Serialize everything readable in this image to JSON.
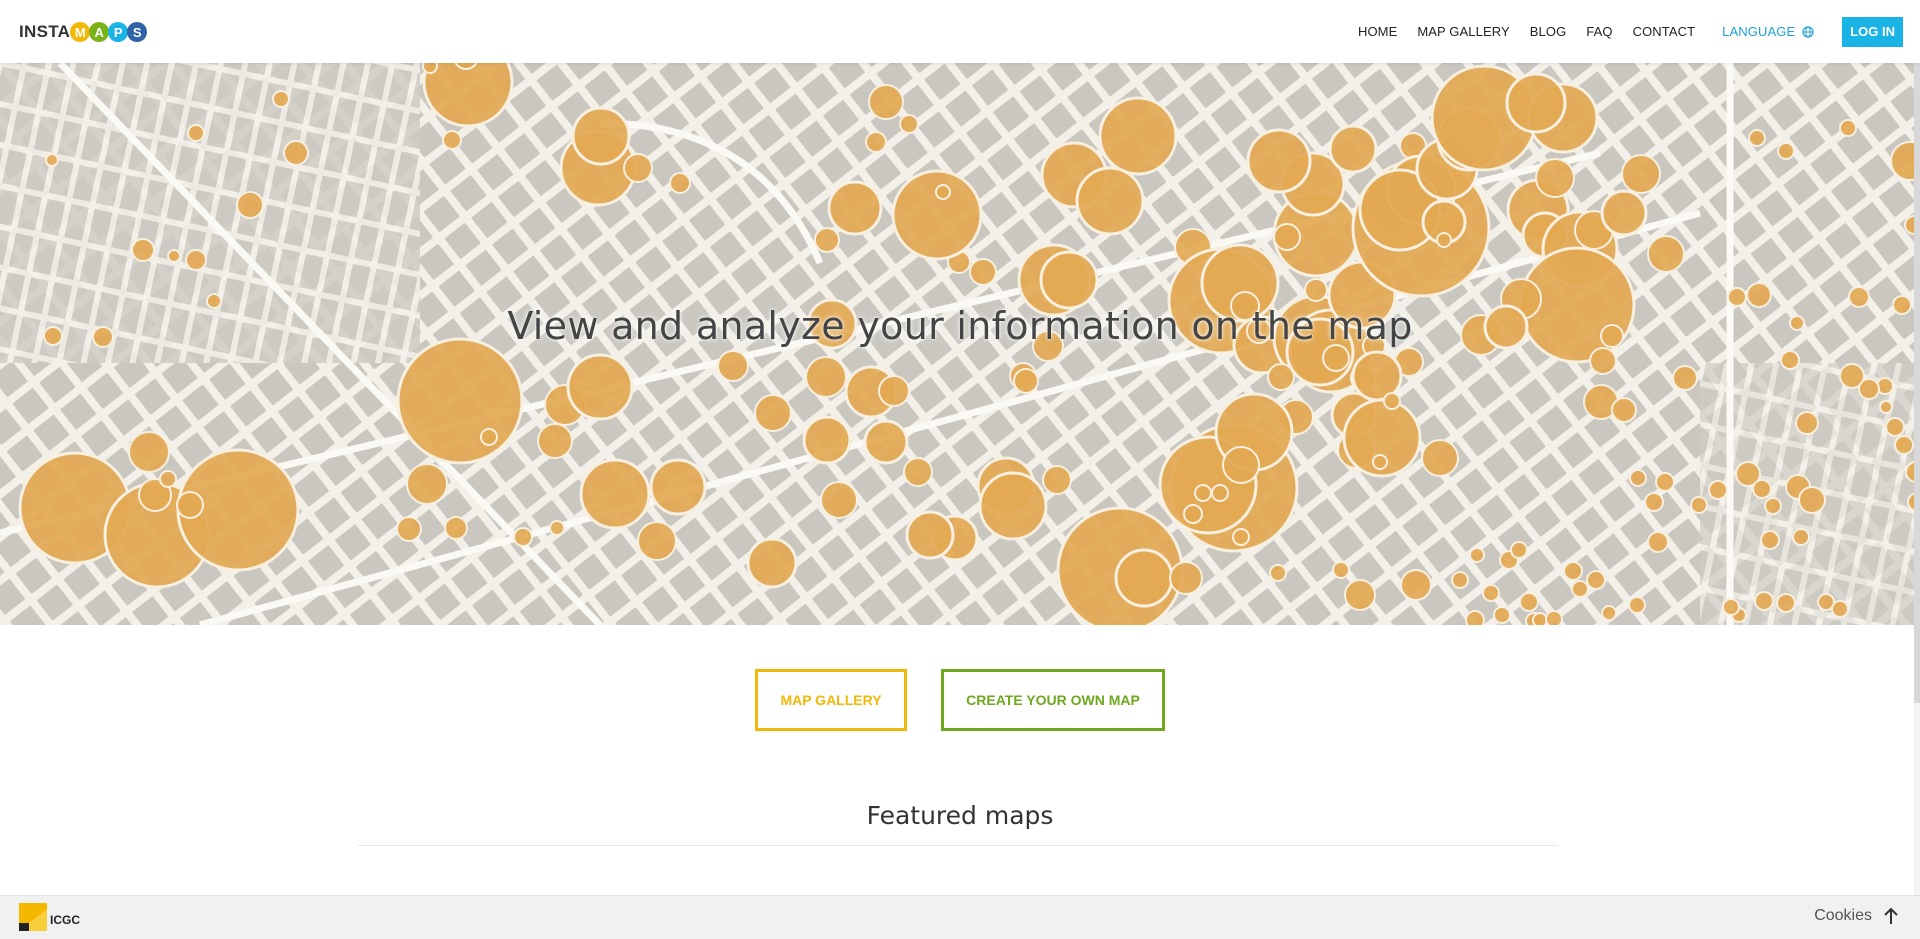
{
  "header": {
    "logo_text": "INSTA",
    "logo_badges": [
      {
        "letter": "M",
        "color": "#f2b807"
      },
      {
        "letter": "A",
        "color": "#7ab317"
      },
      {
        "letter": "P",
        "color": "#1ab3e6"
      },
      {
        "letter": "S",
        "color": "#2f62a6"
      }
    ],
    "nav": [
      "HOME",
      "MAP GALLERY",
      "BLOG",
      "FAQ",
      "CONTACT"
    ],
    "language_label": "LANGUAGE",
    "login_label": "LOG IN"
  },
  "hero": {
    "title": "View and analyze your information on the map",
    "bubble_color": "#e3a852"
  },
  "cta": {
    "gallery_label": "MAP GALLERY",
    "create_label": "CREATE YOUR OWN MAP"
  },
  "featured": {
    "title": "Featured maps"
  },
  "footer": {
    "org_label": "ICGC",
    "cookies_label": "Cookies"
  },
  "colors": {
    "accent_blue": "#1ab3e6",
    "accent_yellow": "#f2b807",
    "accent_green": "#6ea81f"
  }
}
